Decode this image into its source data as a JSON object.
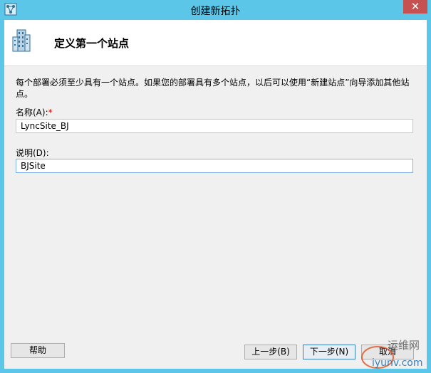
{
  "window": {
    "title": "创建新拓扑",
    "close_glyph": "✕",
    "app_icon": "topology-icon"
  },
  "header": {
    "icon": "building-icon",
    "title": "定义第一个站点"
  },
  "description": "每个部署必须至少具有一个站点。如果您的部署具有多个站点，以后可以使用“新建站点”向导添加其他站点。",
  "form": {
    "name_label": "名称(A):",
    "required_mark": "*",
    "name_value": "LyncSite_BJ",
    "desc_label": "说明(D):",
    "desc_value": "BJSite"
  },
  "buttons": {
    "help": "帮助",
    "back": "上一步(B)",
    "next": "下一步(N)",
    "cancel": "取消"
  },
  "watermark": {
    "line1": "运维网",
    "line2": "iyunv.com"
  },
  "colors": {
    "titlebar": "#5bc6e8",
    "close": "#c75050",
    "client": "#f0f0f0",
    "required": "#d00000"
  }
}
